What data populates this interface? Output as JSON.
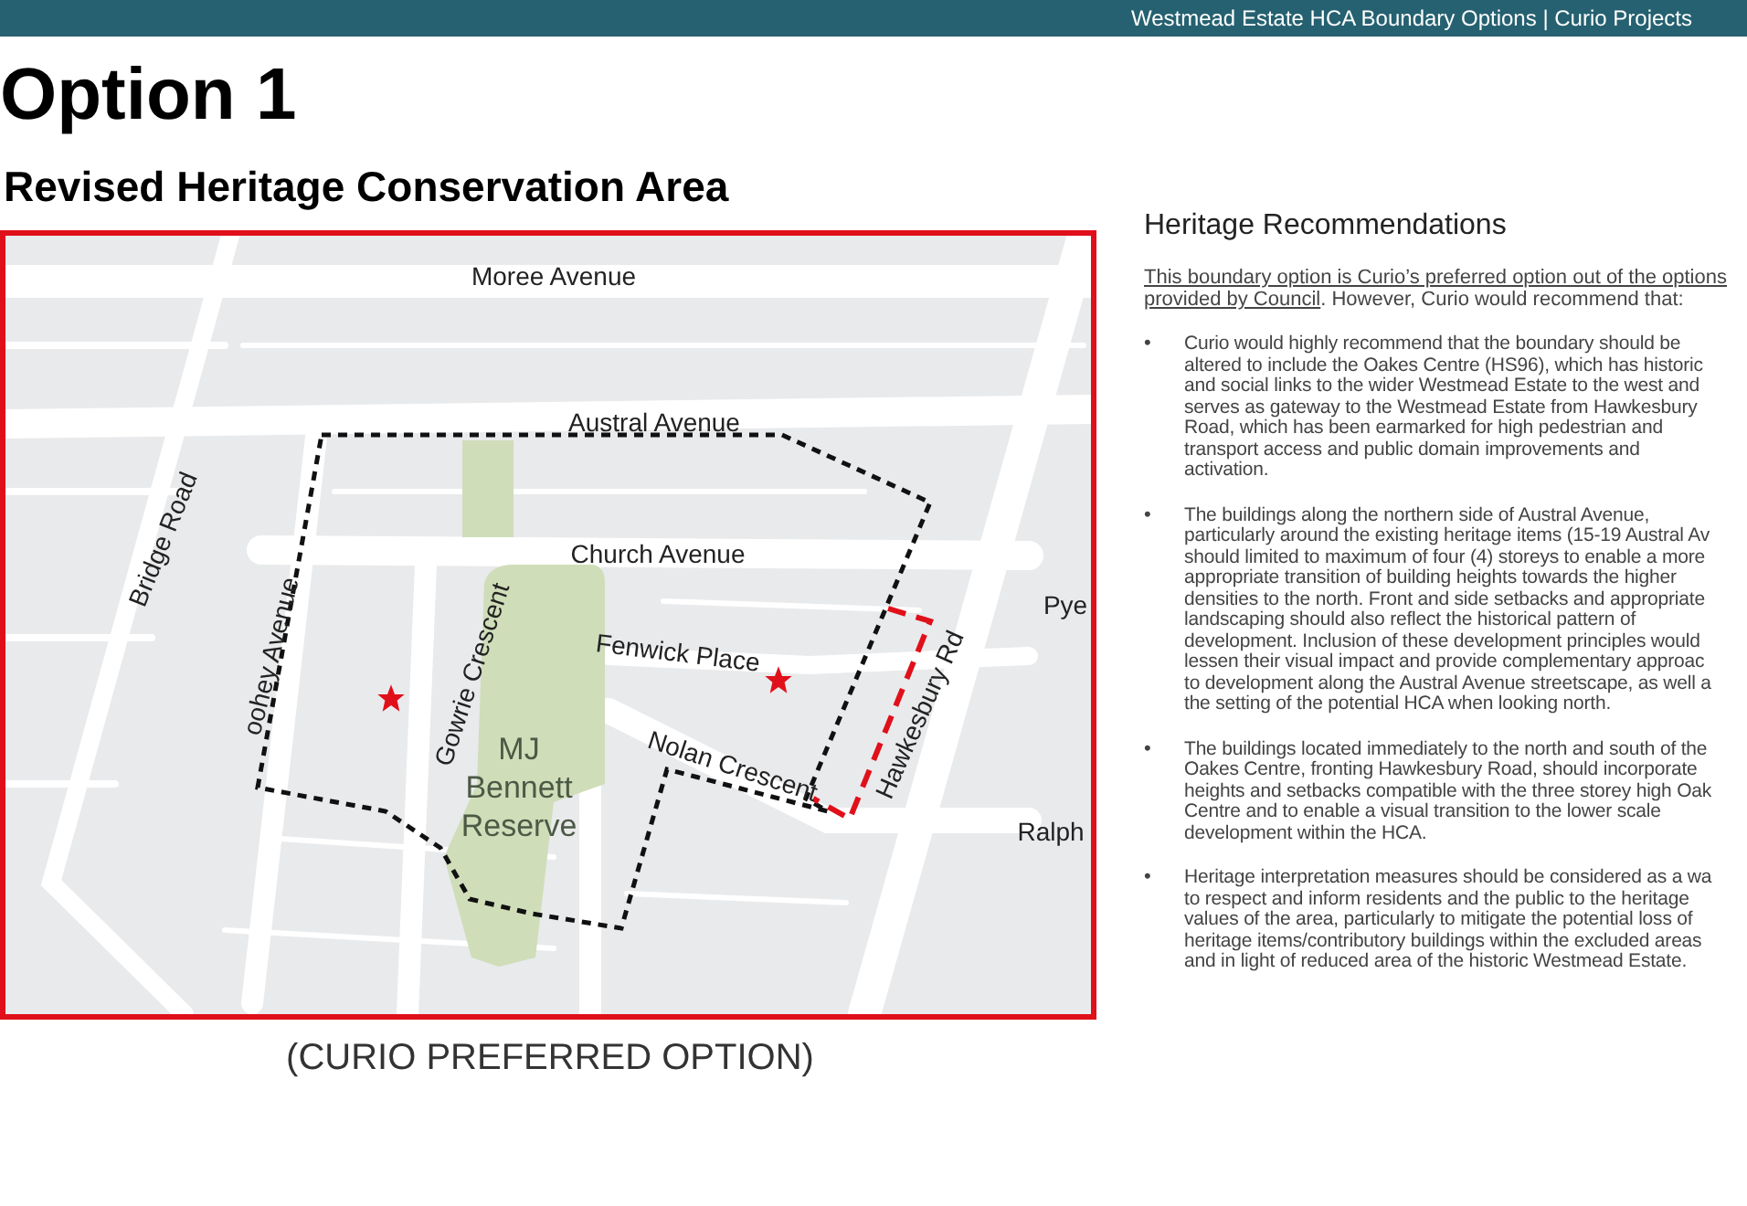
{
  "header": {
    "title": "Westmead Estate HCA Boundary Options | Curio Projects"
  },
  "heading": "Option 1",
  "subheading": "Revised Heritage Conservation Area",
  "map": {
    "caption": "(CURIO PREFERRED OPTION)",
    "labels": [
      {
        "text": "Moree Avenue",
        "kind": "street"
      },
      {
        "text": "Austral Avenue",
        "kind": "street"
      },
      {
        "text": "Church Avenue",
        "kind": "street"
      },
      {
        "text": "Fenwick Place",
        "kind": "street"
      },
      {
        "text": "Nolan Crescent",
        "kind": "street"
      },
      {
        "text": "Hawkesbury Rd",
        "kind": "street"
      },
      {
        "text": "Gowrie Crescent",
        "kind": "street"
      },
      {
        "text": "oohey Avenue",
        "kind": "street"
      },
      {
        "text": "Bridge Road",
        "kind": "street"
      },
      {
        "text": "Pye",
        "kind": "street"
      },
      {
        "text": "Ralph",
        "kind": "street"
      },
      {
        "text": "MJ\nBennett\nReserve",
        "kind": "park"
      }
    ]
  },
  "recommendations": {
    "title": "Heritage Recommendations",
    "intro": {
      "underlined": "This boundary option is Curio’s preferred option out of the options provided by Council",
      "rest": ". However, Curio would recommend that:"
    },
    "bullets": [
      {
        "marker": "•",
        "lines": [
          "Curio would highly recommend that the boundary should be",
          "altered to include the Oakes Centre (HS96), which has historic",
          "and social links to the wider Westmead Estate to the west and",
          "serves as gateway to the Westmead Estate from Hawkesbury",
          "Road, which has been earmarked for high pedestrian and",
          "transport access and public domain improvements and",
          "activation."
        ]
      },
      {
        "marker": "•",
        "lines": [
          "The buildings along the northern side of Austral Avenue,",
          "particularly around the existing heritage items (15-19 Austral Av",
          "should limited to maximum of four (4) storeys to enable a more",
          "appropriate transition of building heights towards the higher",
          "densities to the north. Front and side setbacks and appropriate",
          "landscaping should also reflect the historical pattern of",
          "development. Inclusion of these development principles would",
          "lessen their visual impact and provide complementary approac",
          "to development along the Austral Avenue streetscape, as well a",
          "the setting of the potential HCA when looking north."
        ]
      },
      {
        "marker": "•",
        "lines": [
          "The buildings located immediately to the north and south of the",
          "Oakes Centre, fronting Hawkesbury Road, should incorporate",
          "heights and setbacks compatible with the three storey high Oak",
          "Centre and to enable a visual transition to the lower scale",
          "development within the HCA."
        ]
      },
      {
        "marker": "•",
        "lines": [
          "Heritage interpretation measures should be considered as a wa",
          "to respect and inform residents and the public to the heritage",
          "values of the area, particularly to mitigate the potential loss of",
          "heritage items/contributory buildings within the excluded areas",
          "and in light of reduced area of the historic Westmead Estate."
        ]
      }
    ]
  }
}
